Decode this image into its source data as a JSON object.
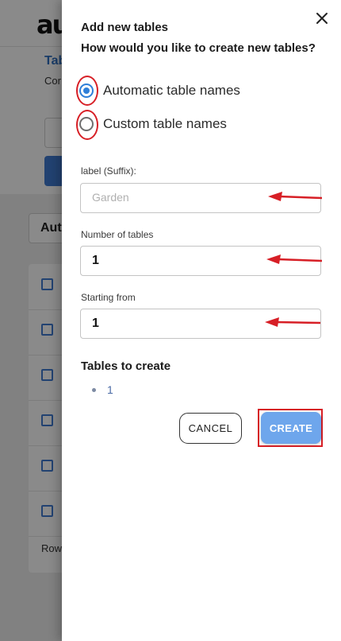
{
  "background_page": {
    "logo": "au",
    "crumb_title": "Tab",
    "crumb_sub": "Cor",
    "select_value": "Aut",
    "rows_label": "Row"
  },
  "drawer": {
    "title": "Add new tables",
    "question": "How would you like to create new tables?",
    "close_icon": "close-icon",
    "options": [
      {
        "label": "Automatic table names",
        "checked": true
      },
      {
        "label": "Custom table names",
        "checked": false
      }
    ],
    "fields": {
      "suffix": {
        "label": "label (Suffix):",
        "value": "",
        "placeholder": "Garden"
      },
      "count": {
        "label": "Number of tables",
        "value": "1",
        "placeholder": ""
      },
      "start": {
        "label": "Starting from",
        "value": "1",
        "placeholder": ""
      }
    },
    "tables_heading": "Tables to create",
    "tables_list": [
      "1"
    ],
    "cancel_label": "CANCEL",
    "create_label": "CREATE"
  },
  "colors": {
    "accent": "#2f7fd8",
    "create_button": "#6ea6ec",
    "annotation_red": "#d71f26",
    "overlay": "rgba(0,0,0,0.46)"
  }
}
